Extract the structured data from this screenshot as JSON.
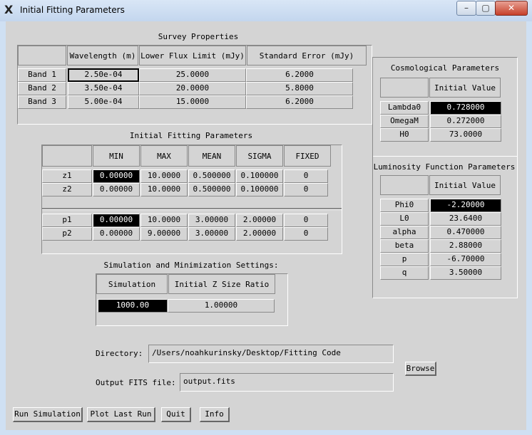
{
  "window": {
    "title": "Initial Fitting Parameters",
    "minimize": "–",
    "maximize": "▢",
    "close": "✕"
  },
  "survey": {
    "caption": "Survey Properties",
    "headers": [
      "Wavelength (m)",
      "Lower Flux Limit (mJy)",
      "Standard Error (mJy)"
    ],
    "rows": [
      {
        "label": "Band 1",
        "values": [
          "2.50e-04",
          "25.0000",
          "6.2000"
        ]
      },
      {
        "label": "Band 2",
        "values": [
          "3.50e-04",
          "20.0000",
          "5.8000"
        ]
      },
      {
        "label": "Band 3",
        "values": [
          "5.00e-04",
          "15.0000",
          "6.2000"
        ]
      }
    ]
  },
  "fitting": {
    "caption": "Initial Fitting Parameters",
    "headers": [
      "MIN",
      "MAX",
      "MEAN",
      "SIGMA",
      "FIXED"
    ],
    "z_rows": [
      {
        "label": "z1",
        "values": [
          "0.00000",
          "10.0000",
          "0.500000",
          "0.100000",
          "0"
        ]
      },
      {
        "label": "z2",
        "values": [
          "0.00000",
          "10.0000",
          "0.500000",
          "0.100000",
          "0"
        ]
      }
    ],
    "p_rows": [
      {
        "label": "p1",
        "values": [
          "0.00000",
          "10.0000",
          "3.00000",
          "2.00000",
          "0"
        ]
      },
      {
        "label": "p2",
        "values": [
          "0.00000",
          "9.00000",
          "3.00000",
          "2.00000",
          "0"
        ]
      }
    ]
  },
  "simulation": {
    "caption": "Simulation and Minimization Settings:",
    "headers": [
      "Simulation Size",
      "Initial Z Size Ratio"
    ],
    "values": [
      "1000.00",
      "1.00000"
    ]
  },
  "cosmology": {
    "caption": "Cosmological Parameters",
    "header": "Initial Value",
    "rows": [
      {
        "label": "Lambda0",
        "value": "0.728000"
      },
      {
        "label": "OmegaM",
        "value": "0.272000"
      },
      {
        "label": "H0",
        "value": "73.0000"
      }
    ]
  },
  "luminosity": {
    "caption": "Luminosity Function Parameters",
    "header": "Initial Value",
    "rows": [
      {
        "label": "Phi0",
        "value": "-2.20000"
      },
      {
        "label": "L0",
        "value": "23.6400"
      },
      {
        "label": "alpha",
        "value": "0.470000"
      },
      {
        "label": "beta",
        "value": "2.88000"
      },
      {
        "label": "p",
        "value": "-6.70000"
      },
      {
        "label": "q",
        "value": "3.50000"
      }
    ]
  },
  "directory": {
    "label": "Directory:",
    "value": "/Users/noahkurinsky/Desktop/Fitting Code",
    "browse": "Browse"
  },
  "output": {
    "label": "Output FITS file:",
    "value": "output.fits"
  },
  "buttons": {
    "run": "Run Simulation",
    "plot": "Plot Last Run",
    "quit": "Quit",
    "info": "Info"
  }
}
